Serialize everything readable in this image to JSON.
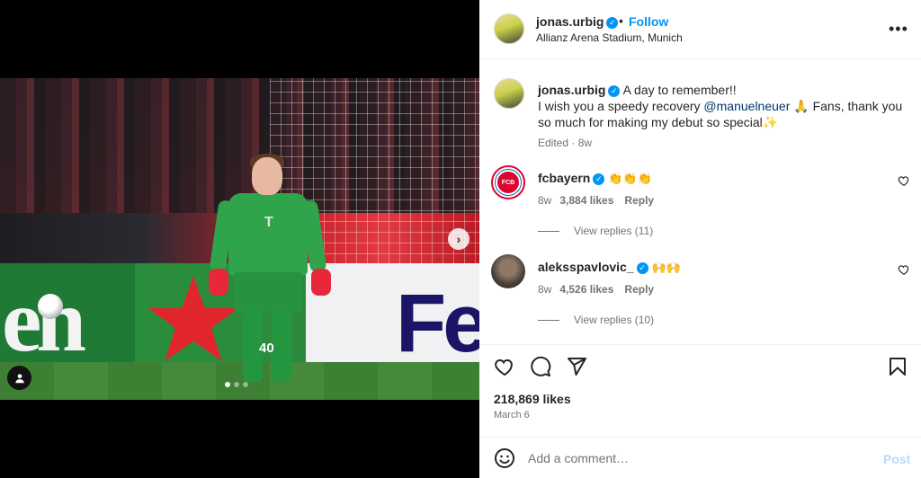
{
  "post": {
    "author": "jonas.urbig",
    "follow_label": "Follow",
    "separator": "•",
    "location": "Allianz Arena Stadium, Munich",
    "more_icon": "more-horizontal-icon",
    "caption_line1": "A day to remember!!",
    "caption_pre_mention": "I wish you a speedy recovery ",
    "mention": "@manuelneuer",
    "caption_post_mention": " 🙏 Fans, thank you so much for making my debut so special",
    "caption_emoji_end": "✨",
    "edited": "Edited · 8w",
    "likes": "218,869 likes",
    "date": "March 6",
    "jersey_number": "40",
    "board_text_left": "en",
    "board_text_right": "Fe",
    "carousel": {
      "count": 3,
      "active": 0
    }
  },
  "comments": [
    {
      "user": "fcbayern",
      "text": "👏👏👏",
      "age": "8w",
      "likes": "3,884 likes",
      "reply_label": "Reply",
      "view_replies": "View replies (11)"
    },
    {
      "user": "aleksspavlovic_",
      "text": "🙌🙌",
      "age": "8w",
      "likes": "4,526 likes",
      "reply_label": "Reply",
      "view_replies": "View replies (10)"
    }
  ],
  "composer": {
    "placeholder": "Add a comment…",
    "post_label": "Post"
  },
  "colors": {
    "accent": "#0095f6",
    "mention": "#00376b",
    "muted": "#737373",
    "post_disabled": "#b3dbff"
  }
}
